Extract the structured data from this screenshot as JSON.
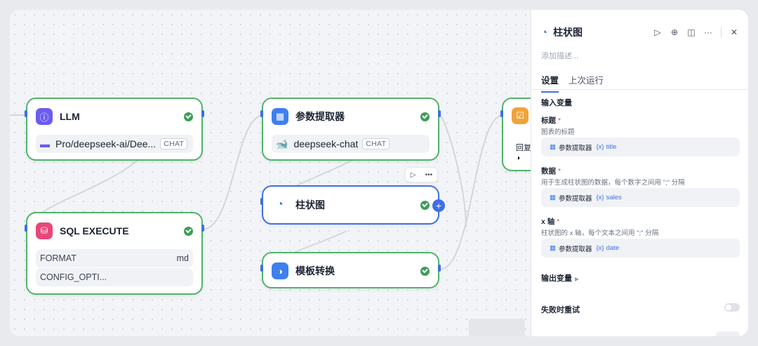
{
  "canvas": {
    "nodes": {
      "llm": {
        "title": "LLM",
        "model": "Pro/deepseek-ai/Dee...",
        "model_tag": "CHAT"
      },
      "sql": {
        "title": "SQL EXECUTE",
        "rows": [
          {
            "key": "FORMAT",
            "value": "md"
          },
          {
            "key": "CONFIG_OPTI...",
            "value": ""
          }
        ]
      },
      "param": {
        "title": "参数提取器",
        "model": "deepseek-chat",
        "model_tag": "CHAT"
      },
      "chart": {
        "title": "柱状图"
      },
      "template": {
        "title": "模板转换"
      },
      "answer": {
        "title": "",
        "text": "回复"
      }
    }
  },
  "panel": {
    "title": "柱状图",
    "description_placeholder": "添加描述...",
    "tabs": [
      {
        "label": "设置"
      },
      {
        "label": "上次运行"
      }
    ],
    "input_section": "输入变量",
    "fields": [
      {
        "label": "标题",
        "required": "*",
        "hint": "图表的标题",
        "source": "参数提取器",
        "var_prefix": "{x}",
        "var": "title"
      },
      {
        "label": "数据",
        "required": "*",
        "hint": "用于生成柱状图的数据，每个数字之间用 \";\" 分隔",
        "source": "参数提取器",
        "var_prefix": "{x}",
        "var": "sales"
      },
      {
        "label": "x 轴",
        "required": "*",
        "hint": "柱状图的 x 轴，每个文本之间用 \";\" 分隔",
        "source": "参数提取器",
        "var_prefix": "{x}",
        "var": "date"
      }
    ],
    "output_section": "输出变量",
    "retry_label": "失败时重试"
  }
}
